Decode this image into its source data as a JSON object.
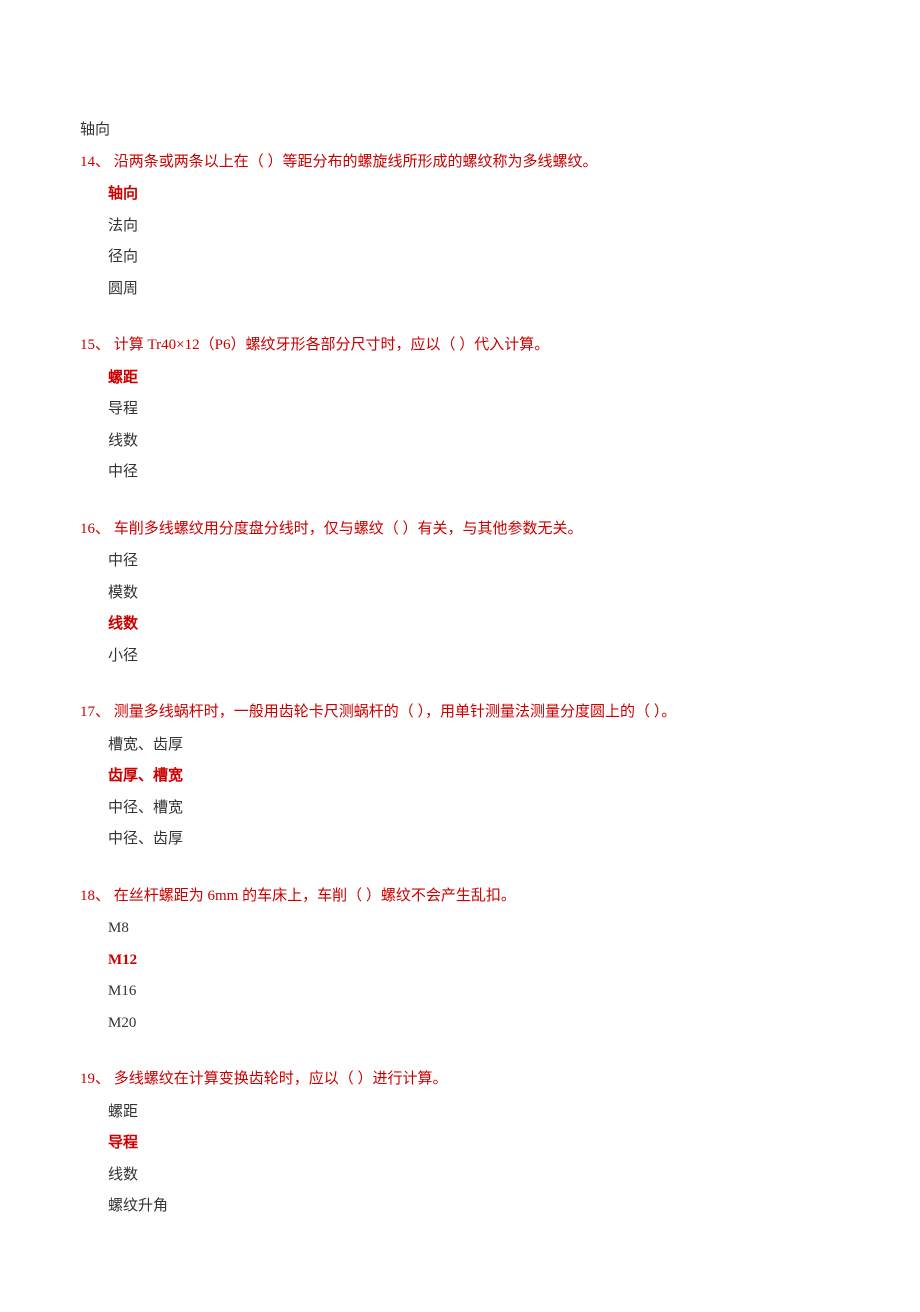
{
  "orphan_option": "轴向",
  "questions": [
    {
      "number": "14、",
      "text": "沿两条或两条以上在（ ）等距分布的螺旋线所形成的螺纹称为多线螺纹。",
      "options": [
        {
          "label": "轴向",
          "correct": true
        },
        {
          "label": "法向",
          "correct": false
        },
        {
          "label": "径向",
          "correct": false
        },
        {
          "label": "圆周",
          "correct": false
        }
      ]
    },
    {
      "number": "15、",
      "text": "计算 Tr40×12（P6）螺纹牙形各部分尺寸时，应以（ ）代入计算。",
      "options": [
        {
          "label": "螺距",
          "correct": true
        },
        {
          "label": "导程",
          "correct": false
        },
        {
          "label": "线数",
          "correct": false
        },
        {
          "label": "中径",
          "correct": false
        }
      ]
    },
    {
      "number": "16、",
      "text": "车削多线螺纹用分度盘分线时，仅与螺纹（ ）有关，与其他参数无关。",
      "options": [
        {
          "label": "中径",
          "correct": false
        },
        {
          "label": "模数",
          "correct": false
        },
        {
          "label": "线数",
          "correct": true
        },
        {
          "label": "小径",
          "correct": false
        }
      ]
    },
    {
      "number": "17、",
      "text": "测量多线蜗杆时，一般用齿轮卡尺测蜗杆的（ ），用单针测量法测量分度圆上的（ ）。",
      "options": [
        {
          "label": "槽宽、齿厚",
          "correct": false
        },
        {
          "label": "齿厚、槽宽",
          "correct": true
        },
        {
          "label": "中径、槽宽",
          "correct": false
        },
        {
          "label": "中径、齿厚",
          "correct": false
        }
      ]
    },
    {
      "number": "18、",
      "text": "在丝杆螺距为 6mm 的车床上，车削（ ）螺纹不会产生乱扣。",
      "options": [
        {
          "label": "M8",
          "correct": false
        },
        {
          "label": "M12",
          "correct": true
        },
        {
          "label": "M16",
          "correct": false
        },
        {
          "label": "M20",
          "correct": false
        }
      ]
    },
    {
      "number": "19、",
      "text": "多线螺纹在计算变换齿轮时，应以（ ）进行计算。",
      "options": [
        {
          "label": "螺距",
          "correct": false
        },
        {
          "label": "导程",
          "correct": true
        },
        {
          "label": "线数",
          "correct": false
        },
        {
          "label": "螺纹升角",
          "correct": false
        }
      ]
    }
  ]
}
